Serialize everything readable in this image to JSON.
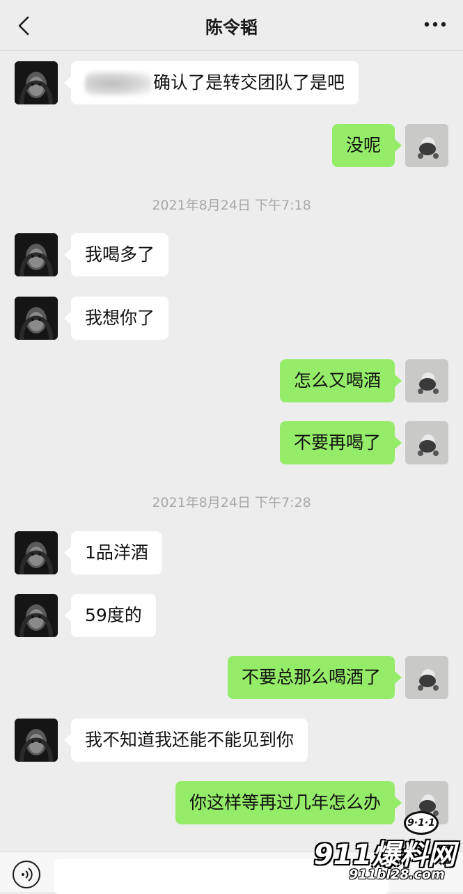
{
  "header": {
    "title": "陈令韬",
    "back_icon": "chevron-left-icon",
    "more_icon": "more-dots-icon"
  },
  "messages": [
    {
      "dir": "in",
      "text": "确认了是转交团队了是吧",
      "redacted_prefix": true
    },
    {
      "dir": "out",
      "text": "没呢"
    },
    {
      "timestamp": "2021年8月24日 下午7:18"
    },
    {
      "dir": "in",
      "text": "我喝多了"
    },
    {
      "dir": "in",
      "text": "我想你了"
    },
    {
      "dir": "out",
      "text": "怎么又喝酒"
    },
    {
      "dir": "out",
      "text": "不要再喝了"
    },
    {
      "timestamp": "2021年8月24日 下午7:28"
    },
    {
      "dir": "in",
      "text": "1品洋酒"
    },
    {
      "dir": "in",
      "text": "59度的"
    },
    {
      "dir": "out",
      "text": "不要总那么喝酒了"
    },
    {
      "dir": "in",
      "text": "我不知道我还能不能见到你"
    },
    {
      "dir": "out",
      "text": "你这样等再过几年怎么办"
    }
  ],
  "bottom": {
    "voice_icon": "voice-icon"
  },
  "watermark": {
    "badge": "9·1·1",
    "big": "911爆料网",
    "site": "911bl28.com"
  },
  "colors": {
    "background": "#ededed",
    "outgoing_bubble": "#95ec69",
    "incoming_bubble": "#ffffff",
    "timestamp": "#a8a8a8"
  }
}
